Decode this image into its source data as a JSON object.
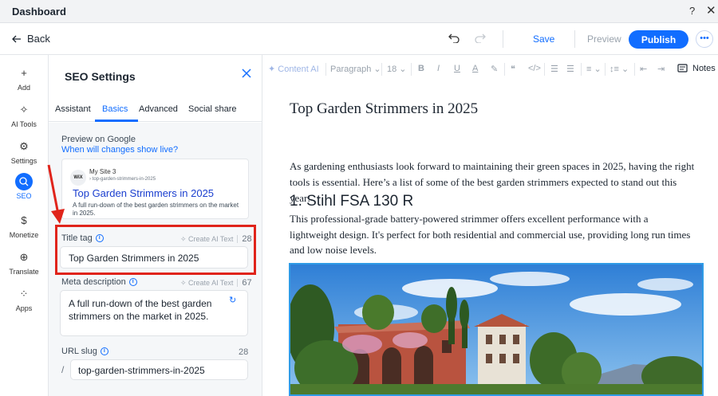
{
  "window": {
    "title": "Dashboard",
    "help_glyph": "?",
    "close_glyph": "✕"
  },
  "toolbar": {
    "back_label": "Back",
    "save_label": "Save",
    "preview_label": "Preview",
    "publish_label": "Publish",
    "more_glyph": "•••"
  },
  "rail": {
    "items": [
      {
        "label": "Add",
        "icon": "plus-icon",
        "glyph": "+"
      },
      {
        "label": "AI Tools",
        "icon": "sparkle-icon",
        "glyph": "✧"
      },
      {
        "label": "Settings",
        "icon": "gear-icon",
        "glyph": "⚙"
      },
      {
        "label": "SEO",
        "icon": "search-icon",
        "glyph": "⌕",
        "active": true
      },
      {
        "label": "Monetize",
        "icon": "dollar-icon",
        "glyph": "$"
      },
      {
        "label": "Translate",
        "icon": "globe-icon",
        "glyph": "⊕"
      },
      {
        "label": "Apps",
        "icon": "apps-icon",
        "glyph": "⁘"
      }
    ]
  },
  "seo_panel": {
    "title": "SEO Settings",
    "tabs": [
      "Assistant",
      "Basics",
      "Advanced",
      "Social share"
    ],
    "active_tab": "Basics",
    "preview_label": "Preview on Google",
    "preview_link": "When will changes show live?",
    "google_preview": {
      "logo_text": "WiX",
      "site_name": "My Site 3",
      "url": "› top-garden-strimmers-in-2025",
      "title": "Top Garden Strimmers in 2025",
      "description": "A full run-down of the best garden strimmers on the market in 2025."
    },
    "title_tag": {
      "label": "Title tag",
      "ai_label": "Create AI Text",
      "count": "28",
      "value": "Top Garden Strimmers in 2025"
    },
    "meta_description": {
      "label": "Meta description",
      "ai_label": "Create AI Text",
      "count": "67",
      "value": "A full run-down of the best garden strimmers on the market in 2025."
    },
    "url_slug": {
      "label": "URL slug",
      "count": "28",
      "prefix": "/",
      "value": "top-garden-strimmers-in-2025"
    }
  },
  "format_toolbar": {
    "content_ai": "Content AI",
    "paragraph": "Paragraph",
    "font_size": "18",
    "notes_label": "Notes"
  },
  "document": {
    "title": "Top Garden Strimmers in 2025",
    "intro": "As gardening enthusiasts look forward to maintaining their green spaces in 2025, having the right tools is essential. Here’s a list of some of the best garden strimmers expected to stand out this year:",
    "heading": "1. Stihl FSA 130 R",
    "paragraph": "This professional-grade battery-powered strimmer offers excellent performance with a lightweight design. It's perfect for both residential and commercial use, providing long run times and low noise levels."
  },
  "colors": {
    "accent": "#116dff",
    "highlight_box": "#e0241b",
    "annotation_arrow": "#e0241b",
    "image_selection": "#2f9be6"
  }
}
